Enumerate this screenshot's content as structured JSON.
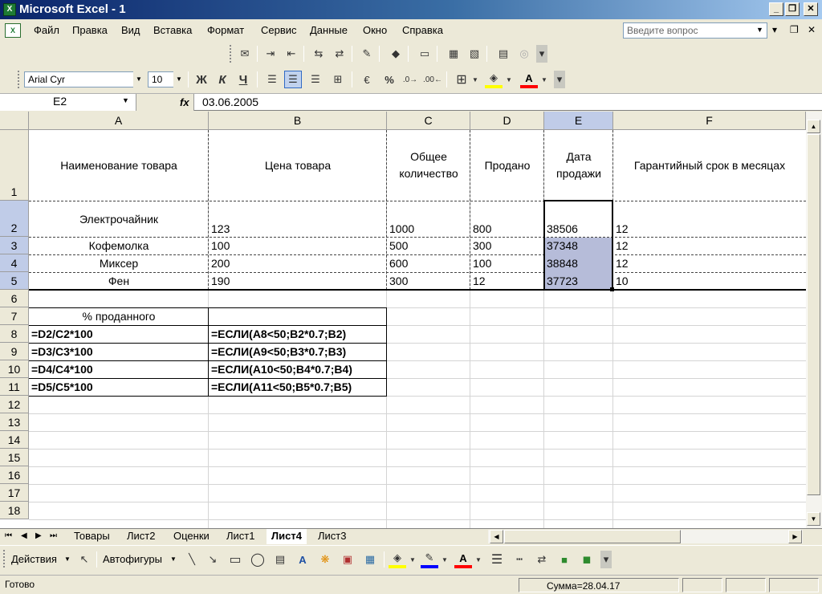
{
  "window": {
    "title": "Microsoft Excel - 1",
    "app_icon": "excel-icon"
  },
  "menu": {
    "items": [
      "Файл",
      "Правка",
      "Вид",
      "Вставка",
      "Формат",
      "Сервис",
      "Данные",
      "Окно",
      "Справка"
    ],
    "help_placeholder": "Введите вопрос"
  },
  "formatting": {
    "font": "Arial Cyr",
    "size": "10",
    "bold": "Ж",
    "italic": "К",
    "underline": "Ч"
  },
  "formula_bar": {
    "name_box": "E2",
    "fx": "fx",
    "value": "03.06.2005"
  },
  "columns": [
    "A",
    "B",
    "C",
    "D",
    "E",
    "F"
  ],
  "rows": [
    "1",
    "2",
    "3",
    "4",
    "5",
    "6",
    "7",
    "8",
    "9",
    "10",
    "11",
    "12",
    "13",
    "14",
    "15",
    "16",
    "17",
    "18"
  ],
  "header_row": {
    "a": "Наименование товара",
    "b": "Цена товара",
    "c1": "Общее",
    "c2": "количество",
    "d": "Продано",
    "e1": "Дата",
    "e2": "продажи",
    "f": "Гарантийный срок в месяцах"
  },
  "data_rows": [
    {
      "name": "Электрочайник",
      "price": "123",
      "total": "1000",
      "sold": "800",
      "date": "38506",
      "warranty": "12"
    },
    {
      "name": "Кофемолка",
      "price": "100",
      "total": "500",
      "sold": "300",
      "date": "37348",
      "warranty": "12"
    },
    {
      "name": "Миксер",
      "price": "200",
      "total": "600",
      "sold": "100",
      "date": "38848",
      "warranty": "12"
    },
    {
      "name": "Фен",
      "price": "190",
      "total": "300",
      "sold": "12",
      "date": "37723",
      "warranty": "10"
    }
  ],
  "calc": {
    "label": "% проданного",
    "rows": [
      {
        "a": "=D2/C2*100",
        "b": "=ЕСЛИ(A8<50;B2*0.7;B2)"
      },
      {
        "a": "=D3/C3*100",
        "b": "=ЕСЛИ(A9<50;B3*0.7;B3)"
      },
      {
        "a": "=D4/C4*100",
        "b": "=ЕСЛИ(A10<50;B4*0.7;B4)"
      },
      {
        "a": "=D5/C5*100",
        "b": "=ЕСЛИ(A11<50;B5*0.7;B5)"
      }
    ]
  },
  "sheets": [
    "Товары",
    "Лист2",
    "Оценки",
    "Лист1",
    "Лист4",
    "Лист3"
  ],
  "active_sheet": "Лист4",
  "drawing": {
    "actions": "Действия",
    "autoshapes": "Автофигуры"
  },
  "status": {
    "ready": "Готово",
    "sum": "Сумма=28.04.17"
  },
  "colors": {
    "selection": "#b6bcd9",
    "title_start": "#0a246a"
  }
}
